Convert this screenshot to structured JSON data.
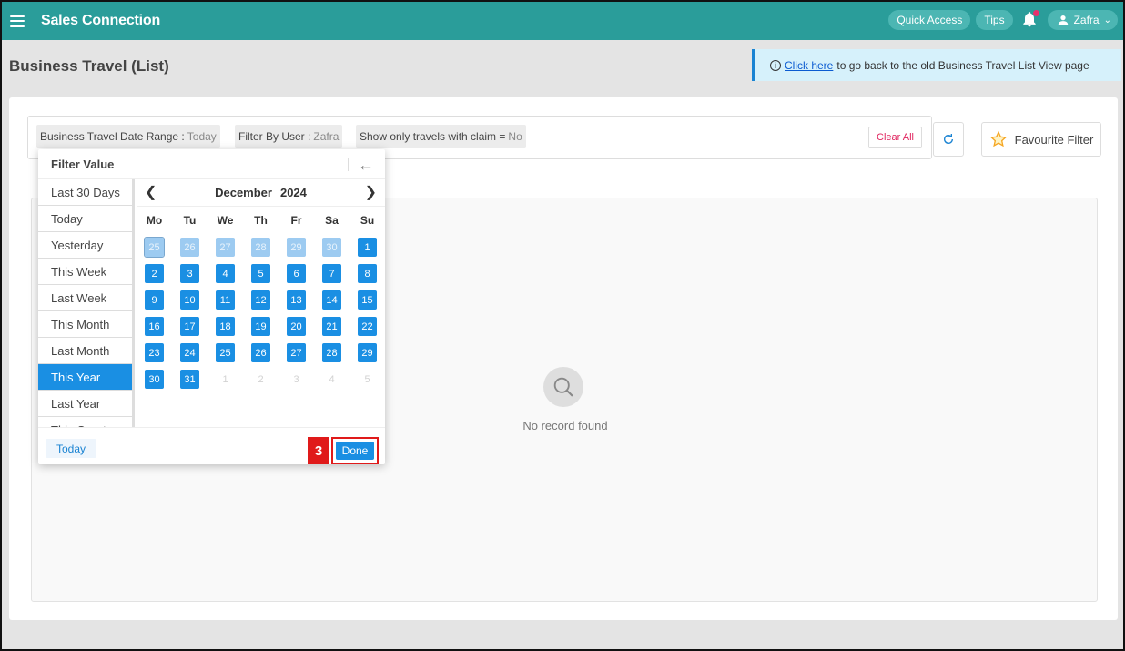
{
  "app": {
    "title": "Sales Connection"
  },
  "topbar": {
    "quick_access": "Quick Access",
    "tips": "Tips",
    "user_name": "Zafra"
  },
  "page": {
    "title": "Business Travel (List)"
  },
  "banner": {
    "link_text": "Click here",
    "text": "to go back to the old Business Travel List View page"
  },
  "filters": {
    "chips": [
      {
        "label": "Business Travel Date Range",
        "value": "Today"
      },
      {
        "label": "Filter By User",
        "value": "Zafra"
      },
      {
        "label": "Show only travels with claim =",
        "value": "No"
      }
    ],
    "clear_all": "Clear All",
    "favourite": "Favourite Filter"
  },
  "records": {
    "empty_text": "No record found"
  },
  "popup": {
    "title": "Filter Value",
    "presets": [
      "Last 30 Days",
      "Today",
      "Yesterday",
      "This Week",
      "Last Week",
      "This Month",
      "Last Month",
      "This Year",
      "Last Year",
      "This Quarter"
    ],
    "active_preset": "This Year",
    "calendar": {
      "month": "December",
      "year": "2024",
      "weekdays": [
        "Mo",
        "Tu",
        "We",
        "Th",
        "Fr",
        "Sa",
        "Su"
      ],
      "weeks": [
        [
          [
            "25",
            "prev"
          ],
          [
            "26",
            "prev"
          ],
          [
            "27",
            "prev"
          ],
          [
            "28",
            "prev"
          ],
          [
            "29",
            "prev"
          ],
          [
            "30",
            "prev"
          ],
          [
            "1",
            "in"
          ]
        ],
        [
          [
            "2",
            "in"
          ],
          [
            "3",
            "in"
          ],
          [
            "4",
            "in"
          ],
          [
            "5",
            "in"
          ],
          [
            "6",
            "in"
          ],
          [
            "7",
            "in"
          ],
          [
            "8",
            "in"
          ]
        ],
        [
          [
            "9",
            "in"
          ],
          [
            "10",
            "in"
          ],
          [
            "11",
            "in"
          ],
          [
            "12",
            "in"
          ],
          [
            "13",
            "in"
          ],
          [
            "14",
            "in"
          ],
          [
            "15",
            "in"
          ]
        ],
        [
          [
            "16",
            "in"
          ],
          [
            "17",
            "in"
          ],
          [
            "18",
            "in"
          ],
          [
            "19",
            "in"
          ],
          [
            "20",
            "in"
          ],
          [
            "21",
            "in"
          ],
          [
            "22",
            "in"
          ]
        ],
        [
          [
            "23",
            "in"
          ],
          [
            "24",
            "in"
          ],
          [
            "25",
            "in"
          ],
          [
            "26",
            "in"
          ],
          [
            "27",
            "in"
          ],
          [
            "28",
            "in"
          ],
          [
            "29",
            "in"
          ]
        ],
        [
          [
            "30",
            "in"
          ],
          [
            "31",
            "in"
          ],
          [
            "1",
            "next"
          ],
          [
            "2",
            "next"
          ],
          [
            "3",
            "next"
          ],
          [
            "4",
            "next"
          ],
          [
            "5",
            "next"
          ]
        ]
      ]
    },
    "today_label": "Today",
    "step_number": "3",
    "done_label": "Done"
  },
  "colors": {
    "topbar": "#2a9d9a",
    "accent": "#1a8fe3",
    "highlight": "#e01a1a"
  }
}
